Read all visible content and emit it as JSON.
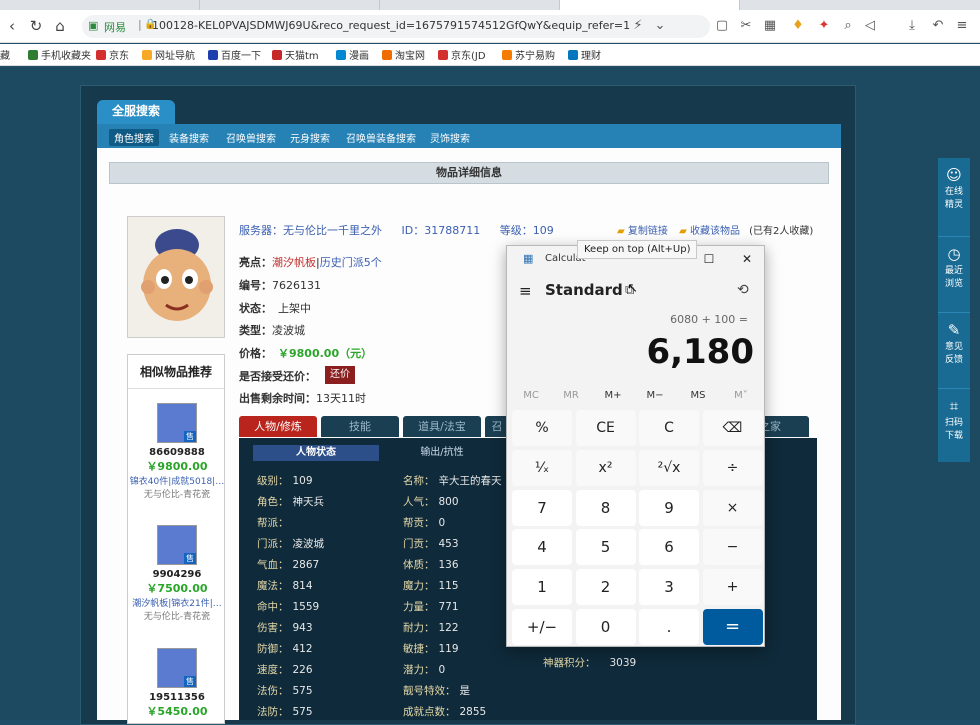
{
  "browser": {
    "tabs": [
      "",
      "",
      "",
      ""
    ],
    "url_site": "网易",
    "url_text": "100128-KEL0PVAJSDMWJ69U&reco_request_id=1675791574512GfQwY&equip_refer=1",
    "bookmarks": [
      "手机收藏夹",
      "京东",
      "网址导航",
      "百度一下",
      "天猫tm",
      "漫画",
      "淘宝网",
      "京东(JD",
      "苏宁易购",
      "理财"
    ],
    "bookmark_prefix": "藏"
  },
  "site": {
    "search_tab": "全服搜索",
    "categories": [
      "角色搜索",
      "装备搜索",
      "召唤兽搜索",
      "元身搜索",
      "召唤兽装备搜索",
      "灵饰搜索"
    ],
    "detail_header": "物品详细信息",
    "server_line": {
      "server_label": "服务器：",
      "server_value": "无与伦比一千里之外",
      "id_label": "ID：",
      "id_value": "31788711",
      "level_label": "等级：",
      "level_value": "109",
      "copy_link": "复制链接",
      "fav": "收藏该物品",
      "fav_count": "(已有2人收藏)"
    },
    "highlight_label": "亮点：",
    "highlight_1": "潮汐帆板",
    "highlight_sep": "|",
    "highlight_2": "历史门派5个",
    "serial_label": "编号：",
    "serial_value": "7626131",
    "status_label": "状态：",
    "status_value": "上架中",
    "type_label": "类型：",
    "type_value": "凌波城",
    "price_label": "价格：",
    "price_value": "￥9800.00（元）",
    "counter_label": "是否接受还价：",
    "counter_btn": "还价",
    "remain_label": "出售剩余时间：",
    "remain_value": "13天11时",
    "recommend_title": "相似物品推荐",
    "recommends": [
      {
        "id": "86609888",
        "price": "￥9800.00",
        "tags": "锦衣40件|成就5018|…",
        "server": "无与伦比-青花瓷",
        "badge": "售"
      },
      {
        "id": "9904296",
        "price": "￥7500.00",
        "tags": "潮汐帆板|锦衣21件|…",
        "server": "无与伦比-青花瓷",
        "badge": "售"
      },
      {
        "id": "19511356",
        "price": "￥5450.00",
        "tags": "",
        "server": "",
        "badge": "售"
      }
    ],
    "detail_tabs": [
      "人物/修炼",
      "技能",
      "道具/法宝",
      "召",
      "",
      "",
      "之家"
    ],
    "stat_tabs": [
      "人物状态",
      "输出/抗性"
    ],
    "stats_left": [
      {
        "k": "级别：",
        "v": "109"
      },
      {
        "k": "角色：",
        "v": "神天兵"
      },
      {
        "k": "帮派：",
        "v": ""
      },
      {
        "k": "门派：",
        "v": "凌波城"
      },
      {
        "k": "气血：",
        "v": "2867"
      },
      {
        "k": "魔法：",
        "v": "814"
      },
      {
        "k": "命中：",
        "v": "1559"
      },
      {
        "k": "伤害：",
        "v": "943"
      },
      {
        "k": "防御：",
        "v": "412"
      },
      {
        "k": "速度：",
        "v": "226"
      },
      {
        "k": "法伤：",
        "v": "575"
      },
      {
        "k": "法防：",
        "v": "575"
      }
    ],
    "stats_right": [
      {
        "k": "名称：",
        "v": "辛大王的春天"
      },
      {
        "k": "人气：",
        "v": "800"
      },
      {
        "k": "帮贡：",
        "v": "0"
      },
      {
        "k": "门贡：",
        "v": "453"
      },
      {
        "k": "体质：",
        "v": "136"
      },
      {
        "k": "魔力：",
        "v": "115"
      },
      {
        "k": "力量：",
        "v": "771"
      },
      {
        "k": "耐力：",
        "v": "122"
      },
      {
        "k": "敏捷：",
        "v": "119"
      },
      {
        "k": "潜力：",
        "v": "0"
      },
      {
        "k": "靓号特效：",
        "v": "是"
      },
      {
        "k": "成就点数：",
        "v": "2855"
      }
    ],
    "weapon_points": {
      "k": "神器积分：",
      "v": "3039"
    }
  },
  "side_tools": [
    {
      "label1": "在线",
      "label2": "精灵",
      "icon": "face-icon"
    },
    {
      "label1": "最近",
      "label2": "浏览",
      "icon": "clock-icon"
    },
    {
      "label1": "意见",
      "label2": "反馈",
      "icon": "edit-icon"
    },
    {
      "label1": "扫码",
      "label2": "下载",
      "icon": "scan-icon"
    }
  ],
  "calculator": {
    "title": "Calculat",
    "tooltip": "Keep on top (Alt+Up)",
    "mode": "Standard",
    "expression": "6080 + 100 =",
    "result": "6,180",
    "memory": [
      "MC",
      "MR",
      "M+",
      "M−",
      "MS",
      "M˅"
    ],
    "keys": [
      [
        "%",
        "CE",
        "C",
        "⌫"
      ],
      [
        "¹⁄ₓ",
        "x²",
        "²√x",
        "÷"
      ],
      [
        "7",
        "8",
        "9",
        "×"
      ],
      [
        "4",
        "5",
        "6",
        "−"
      ],
      [
        "1",
        "2",
        "3",
        "+"
      ],
      [
        "+/−",
        "0",
        ".",
        "="
      ]
    ],
    "accent": "#005a9e"
  }
}
